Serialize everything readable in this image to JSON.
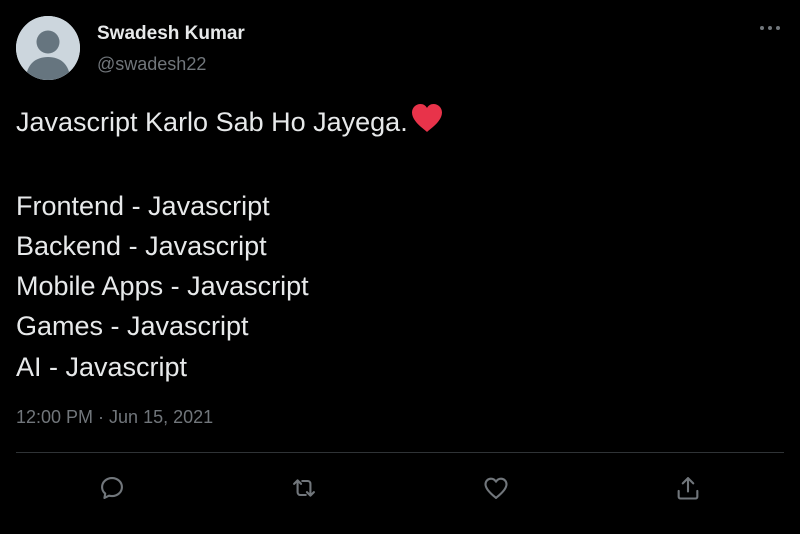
{
  "author": {
    "display_name": "Swadesh Kumar",
    "handle": "@swadesh22"
  },
  "tweet": {
    "lines": [
      "Javascript Karlo Sab Ho Jayega.",
      "",
      "Frontend - Javascript",
      "Backend - Javascript",
      "Mobile Apps - Javascript",
      "Games - Javascript",
      "AI - Javascript"
    ],
    "emoji": "heart-emoji",
    "timestamp": "12:00 PM · Jun 15, 2021"
  },
  "actions": [
    "reply-icon",
    "retweet-icon",
    "like-icon",
    "share-icon"
  ],
  "colors": {
    "background": "#000000",
    "text": "#e7e9ea",
    "secondary_text": "#71767b",
    "divider": "#2f3336",
    "heart": "#e8334a"
  }
}
